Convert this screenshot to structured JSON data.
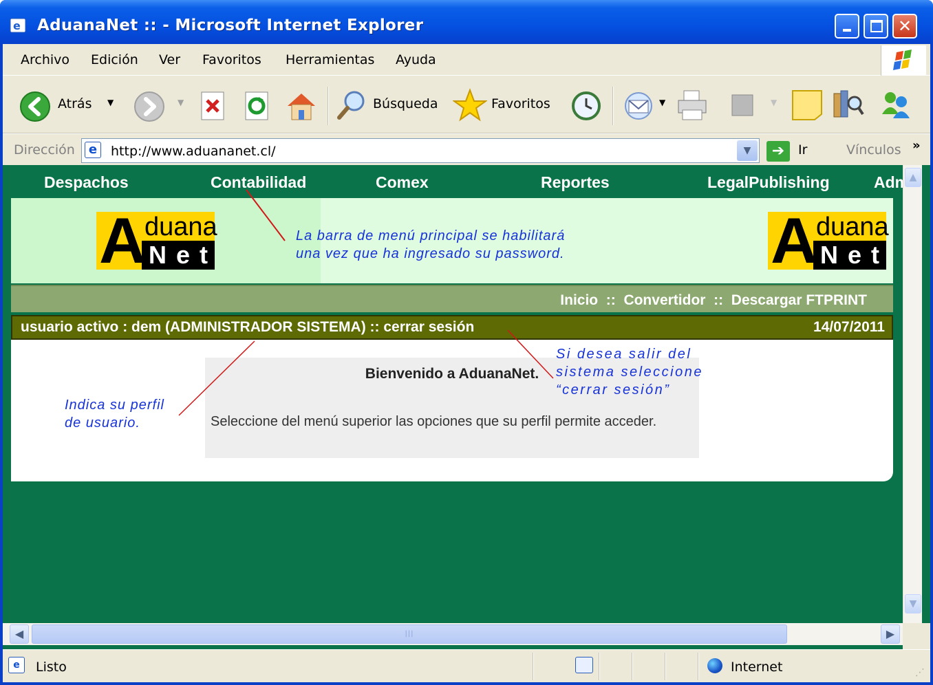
{
  "window": {
    "title": "AduanaNet :: - Microsoft Internet Explorer",
    "minimize_glyph": "",
    "maximize_glyph": "",
    "close_glyph": "✕"
  },
  "menubar": {
    "items": [
      "Archivo",
      "Edición",
      "Ver",
      "Favoritos",
      "Herramientas",
      "Ayuda"
    ]
  },
  "toolbar": {
    "back_label": "Atrás",
    "search_label": "Búsqueda",
    "favorites_label": "Favoritos"
  },
  "addressbar": {
    "label": "Dirección",
    "url": "http://www.aduananet.cl/",
    "go_label": "Ir",
    "links_label": "Vínculos",
    "links_chevron": "»"
  },
  "page": {
    "nav": [
      "Despachos",
      "Contabilidad",
      "Comex",
      "Reportes",
      "LegalPublishing",
      "Adm"
    ],
    "logo": {
      "letter": "A",
      "top": "duana",
      "bottom": "Net"
    },
    "subnav": "Inicio  ::  Convertidor  ::  Descargar FTPRINT",
    "userbar": {
      "text": "usuario activo : dem (ADMINISTRADOR SISTEMA) :: cerrar sesión",
      "date": "14/07/2011"
    },
    "welcome": {
      "title": "Bienvenido a AduanaNet.",
      "body": "Seleccione del menú superior las opciones que su perfil permite acceder."
    }
  },
  "annotations": {
    "menu_note": [
      "La barra de menú principal se habilitará",
      "una vez que ha ingresado su password."
    ],
    "logout_note": [
      "Si desea salir del",
      "sistema seleccione",
      "“cerrar sesión”"
    ],
    "profile_note": [
      "Indica su perfil",
      "de usuario."
    ]
  },
  "statusbar": {
    "status": "Listo",
    "zone": "Internet"
  },
  "colors": {
    "page_green": "#0b7349",
    "header_light": "#dffbe0",
    "userbar_olive": "#5e6b05",
    "annotation_blue": "#1733d8",
    "logo_yellow": "#ffd400"
  }
}
